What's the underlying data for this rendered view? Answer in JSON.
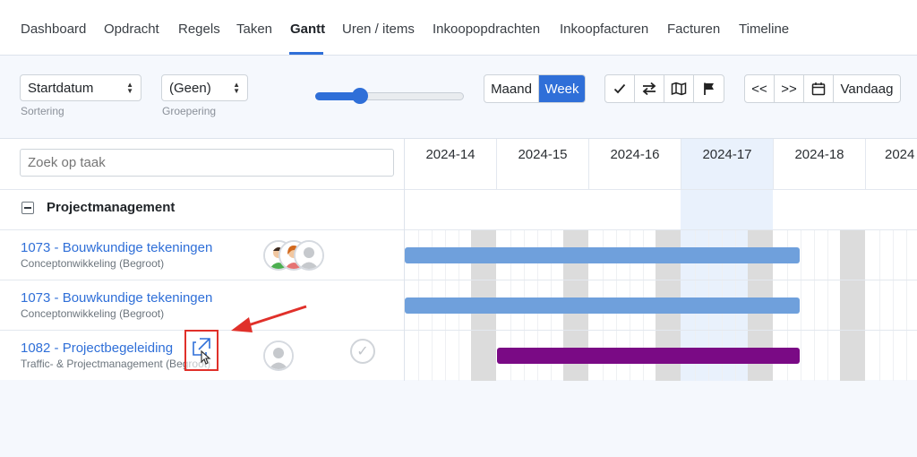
{
  "nav": {
    "tabs": [
      {
        "label": "Dashboard",
        "active": false
      },
      {
        "label": "Opdracht",
        "active": false
      },
      {
        "label": "Regels",
        "active": false
      },
      {
        "label": "Taken",
        "active": false
      },
      {
        "label": "Gantt",
        "active": true
      },
      {
        "label": "Uren / items",
        "active": false
      },
      {
        "label": "Inkoopopdrachten",
        "active": false
      },
      {
        "label": "Inkoopfacturen",
        "active": false
      },
      {
        "label": "Facturen",
        "active": false
      },
      {
        "label": "Timeline",
        "active": false
      }
    ]
  },
  "toolbar": {
    "sort": {
      "value": "Startdatum",
      "label": "Sortering"
    },
    "group": {
      "value": "(Geen)",
      "label": "Groepering"
    },
    "zoom_level": 0.3,
    "view": {
      "month": "Maand",
      "week": "Week",
      "active": "Week"
    },
    "icons": [
      "check-icon",
      "swap-arrows-icon",
      "map-icon",
      "flag-icon"
    ],
    "nav": {
      "prev": "<<",
      "next": ">>",
      "today": "Vandaag"
    }
  },
  "search": {
    "placeholder": "Zoek op taak"
  },
  "timeline": {
    "weeks": [
      "2024-14",
      "2024-15",
      "2024-16",
      "2024-17",
      "2024-18",
      "2024"
    ],
    "highlighted_week": "2024-17"
  },
  "group": {
    "title": "Projectmanagement"
  },
  "tasks": [
    {
      "title": "1073 - Bouwkundige tekeningen",
      "subtitle": "Conceptonwikkeling (Begroot)",
      "bar_color": "#6fa0dc"
    },
    {
      "title": "1073 - Bouwkundige tekeningen",
      "subtitle": "Conceptonwikkeling (Begroot)",
      "bar_color": "#6fa0dc"
    },
    {
      "title": "1082 - Projectbegeleiding",
      "subtitle": "Traffic- & Projectmanagement (Begroot)",
      "bar_color": "#7a0a85"
    }
  ],
  "colors": {
    "accent": "#2f6fd8",
    "highlight": "#e9f1fc",
    "annotation": "#e0302a"
  }
}
